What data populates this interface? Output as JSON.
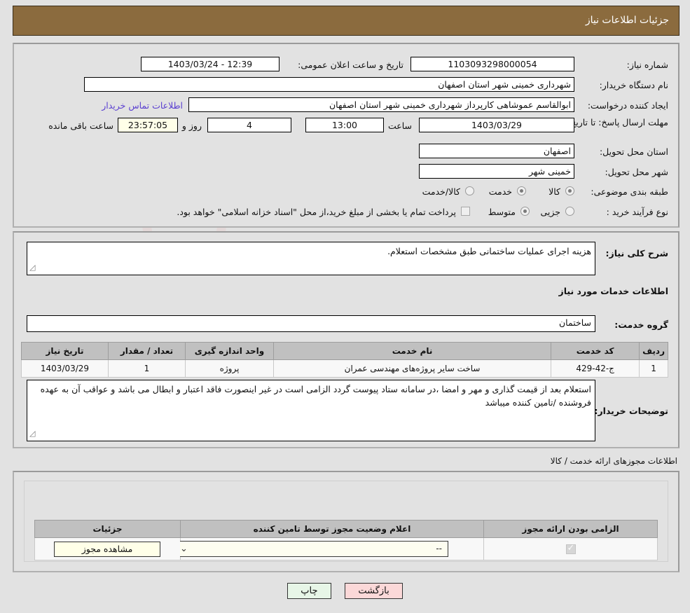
{
  "header": {
    "title": "جزئیات اطلاعات نیاز"
  },
  "main": {
    "need_number_label": "شماره نیاز:",
    "need_number_value": "1103093298000054",
    "announce_label": "تاریخ و ساعت اعلان عمومی:",
    "announce_value": "12:39 - 1403/03/24",
    "buyer_org_label": "نام دستگاه خریدار:",
    "buyer_org_value": "شهرداری خمینی شهر استان اصفهان",
    "creator_label": "ایجاد کننده درخواست:",
    "creator_value": "ابوالقاسم عموشاهی کارپرداز شهرداری خمینی شهر استان اصفهان",
    "contact_link": "اطلاعات تماس خریدار",
    "deadline_label": "مهلت ارسال پاسخ: تا تاریخ:",
    "deadline_date": "1403/03/29",
    "time_label": "ساعت",
    "time_value": "13:00",
    "days_value": "4",
    "days_unit": "روز و",
    "countdown_value": "23:57:05",
    "countdown_suffix": "ساعت باقی مانده",
    "province_label": "استان محل تحویل:",
    "province_value": "اصفهان",
    "city_label": "شهر محل تحویل:",
    "city_value": "خمینی شهر",
    "category_label": "طبقه بندی موضوعی:",
    "category_options": [
      {
        "label": "کالا",
        "selected": false
      },
      {
        "label": "خدمت",
        "selected": true
      },
      {
        "label": "کالا/خدمت",
        "selected": false
      }
    ],
    "process_label": "نوع فرآیند خرید :",
    "process_options": [
      {
        "label": "جزیی",
        "selected": false
      },
      {
        "label": "متوسط",
        "selected": true
      }
    ],
    "treasury_checkbox_label": "پرداخت تمام یا بخشی از مبلغ خرید،از محل \"اسناد خزانه اسلامی\" خواهد بود."
  },
  "description": {
    "need_desc_label": "شرح کلی نیاز:",
    "need_desc_value": "هزینه اجرای عملیات ساختمانی طبق مشخصات استعلام.",
    "services_heading": "اطلاعات خدمات مورد نیاز",
    "service_group_label": "گروه خدمت:",
    "service_group_value": "ساختمان",
    "table_headers": [
      "ردیف",
      "کد خدمت",
      "نام خدمت",
      "واحد اندازه گیری",
      "تعداد / مقدار",
      "تاریخ نیاز"
    ],
    "table_rows": [
      {
        "row": "1",
        "code": "ج-42-429",
        "name": "ساخت سایر پروژه‌های مهندسی عمران",
        "unit": "پروژه",
        "qty": "1",
        "date": "1403/03/29"
      }
    ],
    "buyer_notes_label": "توضیحات خریدار:",
    "buyer_notes_value": "استعلام بعد از قیمت گذاری و مهر و امضا ،در سامانه ستاد پیوست گردد الزامی است در غیر اینصورت فاقد اعتبار و ابطال می باشد و عواقب آن به عهده فروشنده /تامین کننده میباشد"
  },
  "licenses": {
    "section_title": "اطلاعات مجوزهای ارائه خدمت / کالا",
    "table_headers": [
      "الزامی بودن ارائه مجوز",
      "اعلام وضعیت مجوز توسط تامین کننده",
      "جزئیات"
    ],
    "rows": [
      {
        "required_checked": true,
        "status_value": "--",
        "detail_button": "مشاهده مجوز"
      }
    ]
  },
  "footer": {
    "print_label": "چاپ",
    "back_label": "بازگشت"
  },
  "watermark": {
    "text": "anaTender.net"
  }
}
